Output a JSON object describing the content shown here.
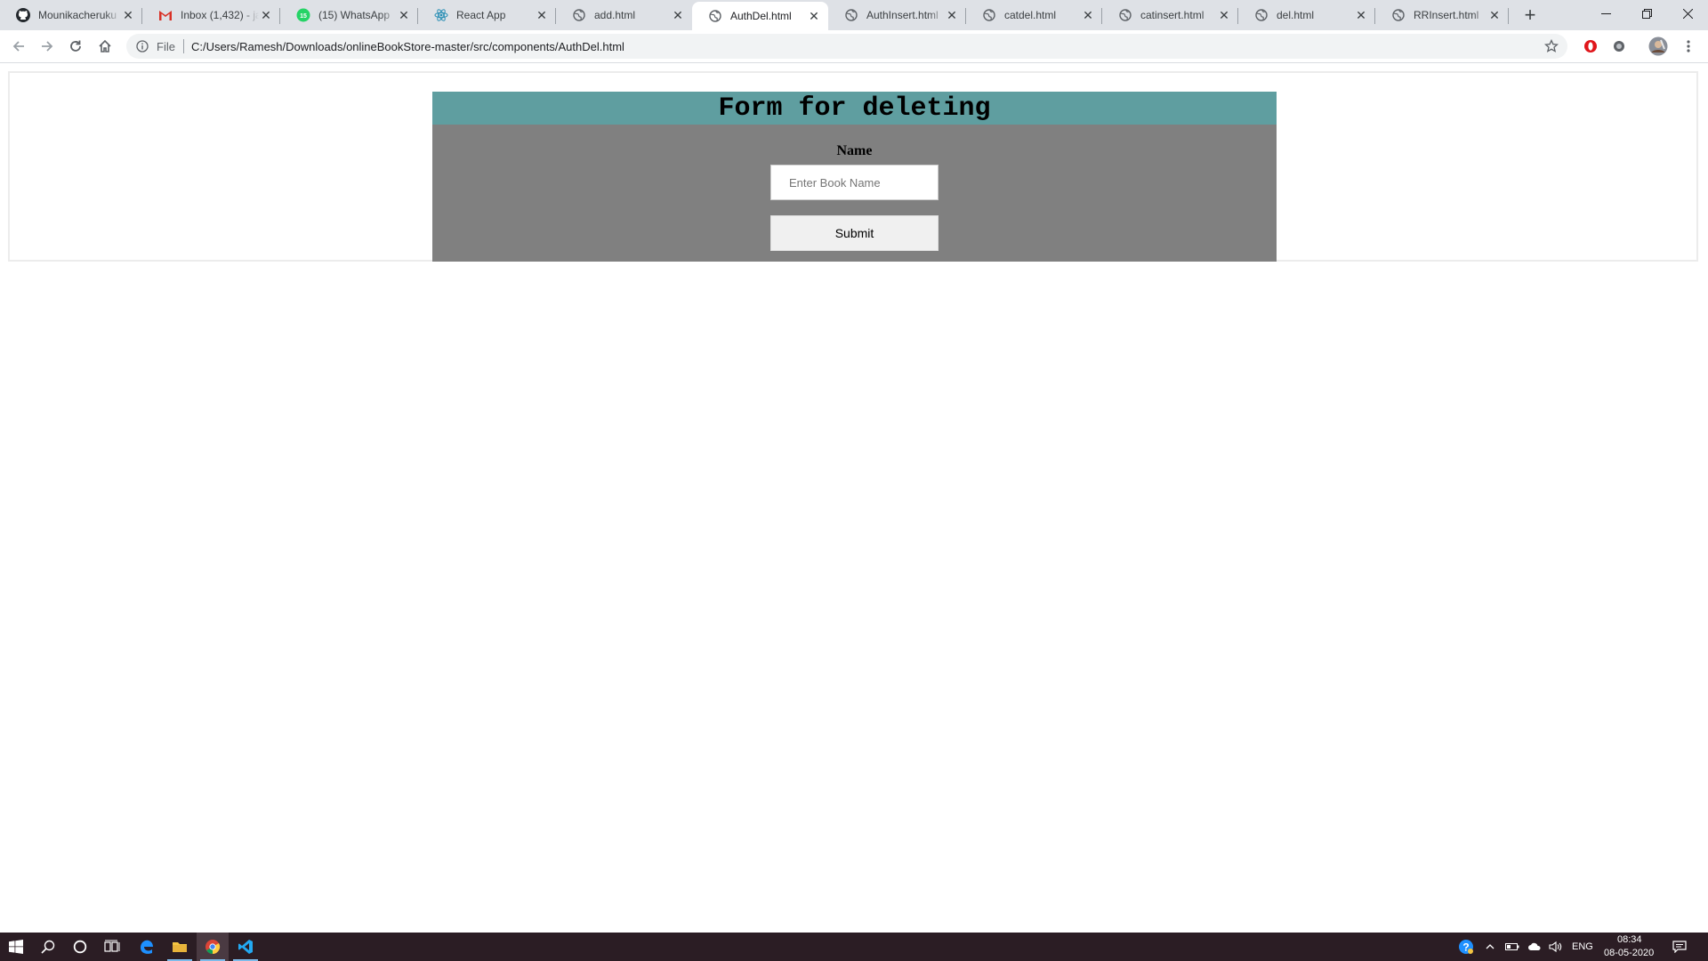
{
  "browser": {
    "tabs": [
      {
        "label": "Mounikacheruku",
        "icon": "github-icon",
        "active": false
      },
      {
        "label": "Inbox (1,432) - ja",
        "icon": "gmail-icon",
        "active": false
      },
      {
        "label": "(15) WhatsApp",
        "icon": "whatsapp-icon",
        "active": false
      },
      {
        "label": "React App",
        "icon": "react-icon",
        "active": false
      },
      {
        "label": "add.html",
        "icon": "globe-icon",
        "active": false
      },
      {
        "label": "AuthDel.html",
        "icon": "globe-icon",
        "active": true
      },
      {
        "label": "AuthInsert.html",
        "icon": "globe-icon",
        "active": false
      },
      {
        "label": "catdel.html",
        "icon": "globe-icon",
        "active": false
      },
      {
        "label": "catinsert.html",
        "icon": "globe-icon",
        "active": false
      },
      {
        "label": "del.html",
        "icon": "globe-icon",
        "active": false
      },
      {
        "label": "RRInsert.html",
        "icon": "globe-icon",
        "active": false
      }
    ],
    "address": {
      "scheme_label": "File",
      "url": "C:/Users/Ramesh/Downloads/onlineBookStore-master/src/components/AuthDel.html"
    }
  },
  "page": {
    "form_title": "Form for deleting",
    "name_label": "Name",
    "name_placeholder": "Enter Book Name",
    "name_value": "",
    "submit_label": "Submit"
  },
  "taskbar": {
    "language": "ENG",
    "time": "08:34",
    "date": "08-05-2020"
  },
  "colors": {
    "form_header": "#5f9ea0",
    "form_body": "#808080",
    "tab_strip": "#dee1e6",
    "taskbar": "#2b1d24"
  }
}
